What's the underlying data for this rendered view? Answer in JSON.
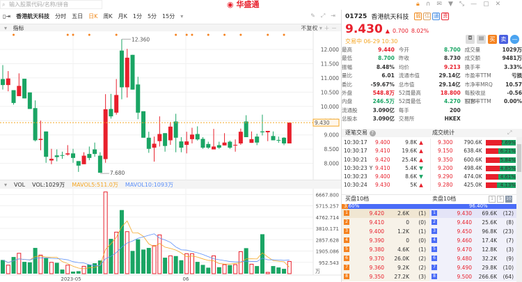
{
  "search": {
    "placeholder": "输入股票代码/名称/拼音"
  },
  "logo": "华盛通",
  "toolbar": {
    "stock_name": "香港航天科技",
    "periods": [
      "分时",
      "五日",
      "日K",
      "周K",
      "月K",
      "1分",
      "5分",
      "15分"
    ],
    "active": "日K"
  },
  "indicator_bar": {
    "label": "指标",
    "adjust": "不复权"
  },
  "chart_data": [
    {
      "type": "candlestick",
      "title": "香港航天科技 日K",
      "yticks": [
        "12.000",
        "11.500",
        "11.000",
        "10.500",
        "10.000",
        "9.500",
        "9.000",
        "8.500",
        "8.000"
      ],
      "ylim": [
        7.6,
        12.4
      ],
      "current_price_label": "9.430",
      "max_label": "12.360",
      "min_label": "7.680",
      "event_marker_indices": [
        2,
        12,
        13,
        16,
        21,
        32,
        34,
        35,
        38,
        41,
        44,
        49,
        52
      ],
      "ohlc": [
        [
          10.96,
          11.45,
          10.59,
          10.75
        ],
        [
          10.75,
          11.24,
          10.53,
          10.98
        ],
        [
          10.57,
          10.57,
          10.06,
          10.12
        ],
        [
          10.36,
          11.16,
          10.36,
          10.72
        ],
        [
          10.97,
          10.97,
          10.28,
          10.28
        ],
        [
          10.49,
          10.49,
          9.91,
          9.91
        ],
        [
          9.94,
          10.21,
          8.77,
          8.81
        ],
        [
          8.82,
          9.5,
          8.46,
          8.86
        ],
        [
          9.12,
          9.12,
          8.02,
          8.23
        ],
        [
          8.1,
          8.51,
          7.97,
          8.16
        ],
        [
          8.28,
          8.49,
          8.07,
          8.22
        ],
        [
          8.29,
          8.41,
          8.16,
          8.27
        ],
        [
          8.31,
          8.64,
          8.27,
          8.35
        ],
        [
          8.35,
          8.51,
          8.02,
          8.19
        ],
        [
          8.08,
          8.08,
          7.7,
          7.92
        ],
        [
          7.97,
          8.39,
          7.97,
          8.27
        ],
        [
          8.33,
          8.59,
          8.11,
          8.19
        ],
        [
          8.49,
          8.73,
          8.23,
          8.33
        ],
        [
          8.27,
          8.39,
          7.68,
          7.67
        ],
        [
          8.15,
          10.43,
          8.02,
          9.9
        ],
        [
          9.91,
          10.44,
          9.57,
          9.65
        ],
        [
          9.78,
          10.96,
          9.71,
          10.4
        ],
        [
          11.96,
          12.36,
          10.25,
          10.67
        ],
        [
          10.67,
          12.02,
          10.31,
          11.71
        ],
        [
          11.81,
          11.81,
          10.59,
          10.59
        ],
        [
          10.77,
          11.04,
          9.55,
          9.78
        ],
        [
          9.83,
          9.83,
          8.9,
          8.9
        ],
        [
          8.9,
          9.11,
          8.37,
          8.51
        ],
        [
          8.55,
          8.94,
          8.06,
          8.69
        ],
        [
          8.78,
          9.65,
          8.59,
          9.03
        ],
        [
          9.06,
          9.06,
          8.41,
          8.61
        ],
        [
          8.81,
          9.45,
          8.65,
          9.29
        ],
        [
          9.47,
          9.74,
          8.39,
          8.9
        ],
        [
          8.77,
          8.92,
          8.39,
          8.55
        ],
        [
          8.65,
          9.11,
          8.35,
          8.77
        ],
        [
          8.85,
          9.25,
          8.7,
          9.01
        ],
        [
          9.03,
          9.3,
          8.8,
          8.84
        ],
        [
          8.86,
          8.92,
          8.51,
          8.55
        ],
        [
          8.68,
          8.76,
          8.51,
          8.55
        ],
        [
          8.49,
          9.21,
          8.49,
          8.59
        ],
        [
          8.64,
          8.76,
          8.51,
          8.55
        ],
        [
          8.63,
          9.06,
          8.63,
          8.73
        ],
        [
          8.76,
          8.8,
          8.51,
          8.55
        ],
        [
          8.63,
          8.84,
          8.41,
          8.65
        ],
        [
          8.7,
          9.22,
          8.65,
          9.11
        ],
        [
          9.47,
          9.69,
          8.92,
          8.92
        ],
        [
          8.72,
          9.12,
          8.72,
          8.85
        ],
        [
          8.94,
          9.04,
          8.64,
          8.73
        ],
        [
          9.12,
          9.71,
          8.98,
          9.09
        ],
        [
          9.09,
          9.14,
          8.78,
          9.14
        ],
        [
          8.96,
          9.12,
          8.81,
          8.81
        ],
        [
          8.82,
          8.94,
          8.72,
          8.8
        ],
        [
          8.9,
          8.92,
          8.64,
          8.7
        ],
        [
          8.7,
          9.44,
          8.7,
          9.43
        ]
      ]
    },
    {
      "type": "bar",
      "title": "VOL",
      "unit": "万",
      "yticks": [
        "6667.800",
        "5715.257",
        "4762.714",
        "3810.171",
        "2857.628",
        "1905.086",
        "952.543"
      ],
      "ylim": [
        0,
        6667.8
      ],
      "xticks": [
        "2023-05",
        "06"
      ],
      "values": [
        1149,
        718,
        1403,
        1716,
        992,
        953,
        2167,
        1560,
        1305,
        953,
        914,
        346,
        718,
        170,
        209,
        620,
        757,
        875,
        1110,
        6880,
        2930,
        3497,
        5356,
        3536,
        1912,
        2890,
        2029,
        2167,
        2362,
        3262,
        1344,
        1500,
        1481,
        1129,
        1677,
        1677,
        992,
        738,
        503,
        1500,
        542,
        757,
        718,
        757,
        1853,
        2148,
        796,
        640,
        3321,
        112,
        640,
        522,
        405,
        1029
      ],
      "legend": {
        "vol": "VOL:1029万",
        "mavol5": "MAVOL5:511.0万",
        "mavol10": "MAVOL10:1093万"
      },
      "colors": {
        "up": "#e8202c",
        "down": "#1aa564",
        "ma5": "#f5a623",
        "ma10": "#5b8ff9"
      }
    }
  ],
  "quote": {
    "code": "01725",
    "name": "香港航天科技",
    "badges": [
      "融",
      "估",
      "通",
      "资"
    ],
    "price": "9.430",
    "change": "0.700",
    "pct": "8.02%",
    "status": "交易中 06-29 10:30",
    "buttons": [
      "买",
      "卖"
    ]
  },
  "stats": [
    [
      "最高",
      "9.440",
      "今开",
      "8.700",
      "成交量",
      "1029万"
    ],
    [
      "最低",
      "8.700",
      "昨收",
      "8.730",
      "成交额",
      "9481万"
    ],
    [
      "振幅",
      "8.48%",
      "均价",
      "9.213",
      "换手率",
      "3.33%"
    ],
    [
      "量比",
      "6.01",
      "流通市值",
      "29.14亿",
      "市盈率TTM",
      "亏损"
    ],
    [
      "委比",
      "-59.67%",
      "总市值",
      "29.14亿",
      "市净率MRQ",
      "10.57"
    ],
    [
      "外盘",
      "548.8万",
      "52周最高",
      "18.800",
      "每股收益TTM",
      "-0.56"
    ],
    [
      "内盘",
      "246.5万",
      "52周最低",
      "4.270",
      "股息率TTM",
      "0.00%"
    ],
    [
      "流通股",
      "3.090亿",
      "每手",
      "200",
      "",
      ""
    ],
    [
      "总股本",
      "3.090亿",
      "交易所",
      "HKEX",
      "",
      ""
    ]
  ],
  "ticks": {
    "title": "逐笔交易",
    "rows": [
      [
        "10:30:17",
        "",
        "9.400",
        "9.8K",
        "up"
      ],
      [
        "10:30:17",
        "",
        "9.410",
        "19.6K",
        "up"
      ],
      [
        "10:30:21",
        "",
        "9.420",
        "25.4K",
        "up"
      ],
      [
        "10:30:23",
        "Y",
        "9.410",
        "5.4K",
        "down"
      ],
      [
        "10:30:23",
        "",
        "9.400",
        "8.6K",
        "down"
      ],
      [
        "10:30:24",
        "",
        "9.430",
        "5K",
        "up"
      ]
    ]
  },
  "volstats": {
    "title": "成交统计",
    "rows": [
      [
        "9.300",
        "790.6K",
        "7.69%",
        0.9
      ],
      [
        "9.150",
        "638.4K",
        "6.21%",
        0.72
      ],
      [
        "9.350",
        "600.6K",
        "5.84%",
        0.78
      ],
      [
        "9.200",
        "498.4K",
        "4.85%",
        0.8
      ],
      [
        "9.290",
        "474.0K",
        "4.61%",
        0.7
      ],
      [
        "9.280",
        "425.0K",
        "4.13%",
        0.62
      ]
    ]
  },
  "orderbook": {
    "bid_title": "买盘10档",
    "ask_title": "卖盘10档",
    "levels": [
      "1",
      "5",
      "10"
    ],
    "bid_pct": "3.60%",
    "ask_pct": "96.40%",
    "bid_ratio": 0.036,
    "bids": [
      [
        "1",
        "9.420",
        "2.6K",
        "(1)"
      ],
      [
        "2",
        "9.410",
        "0",
        "(0)"
      ],
      [
        "3",
        "9.400",
        "1.2K",
        "(1)"
      ],
      [
        "4",
        "9.390",
        "0",
        "(0)"
      ],
      [
        "5",
        "9.380",
        "4.6K",
        "(1)"
      ],
      [
        "6",
        "9.370",
        "26.0K",
        "(2)"
      ],
      [
        "7",
        "9.360",
        "9.2K",
        "(2)"
      ],
      [
        "8",
        "9.350",
        "27.2K",
        "(3)"
      ]
    ],
    "asks": [
      [
        "1",
        "9.430",
        "69.6K",
        "(12)"
      ],
      [
        "2",
        "9.440",
        "25.6K",
        "(8)"
      ],
      [
        "3",
        "9.450",
        "96.8K",
        "(23)"
      ],
      [
        "4",
        "9.460",
        "17.4K",
        "(7)"
      ],
      [
        "5",
        "9.470",
        "12.8K",
        "(3)"
      ],
      [
        "6",
        "9.480",
        "32.2K",
        "(9)"
      ],
      [
        "7",
        "9.490",
        "29.8K",
        "(10)"
      ],
      [
        "8",
        "9.500",
        "266.6K",
        "(64)"
      ]
    ]
  }
}
